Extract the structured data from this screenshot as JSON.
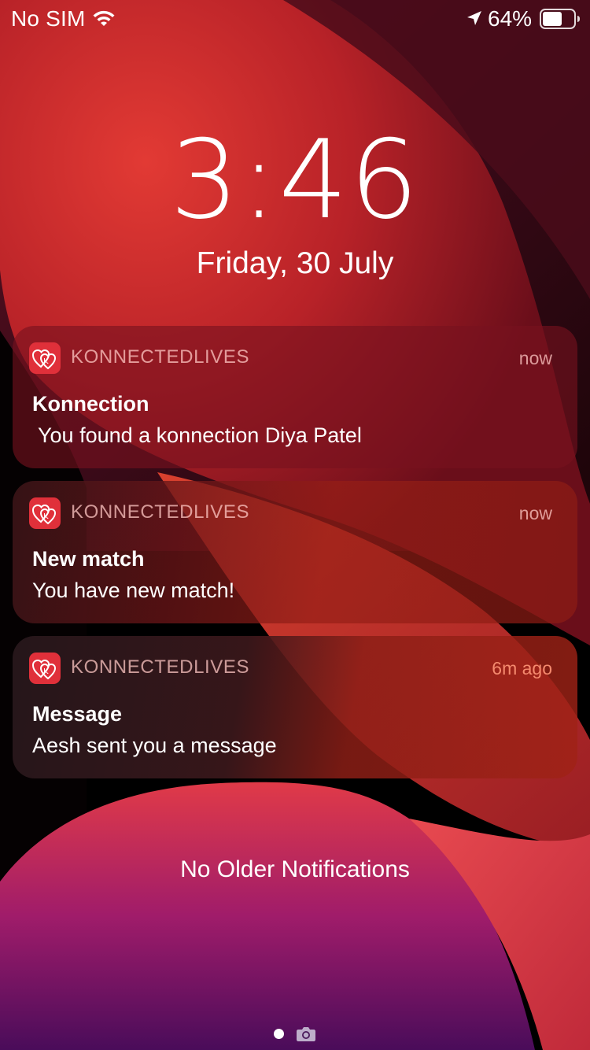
{
  "status_bar": {
    "carrier": "No SIM",
    "battery_percent": "64%",
    "battery_level": 0.64,
    "icons": [
      "wifi-icon",
      "location-arrow-icon",
      "battery-icon"
    ]
  },
  "lock_screen": {
    "time": "3:46",
    "date": "Friday, 30 July"
  },
  "notifications": [
    {
      "app_name": "KONNECTEDLIVES",
      "time": "now",
      "title": "Konnection",
      "body": " You found a konnection Diya Patel",
      "icon": "konnectedlives-app-icon"
    },
    {
      "app_name": "KONNECTEDLIVES",
      "time": "now",
      "title": "New match",
      "body": "You have new match!",
      "icon": "konnectedlives-app-icon"
    },
    {
      "app_name": "KONNECTEDLIVES",
      "time": "6m ago",
      "title": "Message",
      "body": "Aesh sent you a message",
      "icon": "konnectedlives-app-icon"
    }
  ],
  "footer": {
    "no_older_label": "No Older Notifications",
    "icons": [
      "page-indicator-dot",
      "camera-icon"
    ]
  },
  "colors": {
    "app_icon_bg": "#e0303a",
    "wallpaper_primary": "#c8282e",
    "wallpaper_dark": "#3a0a14"
  }
}
